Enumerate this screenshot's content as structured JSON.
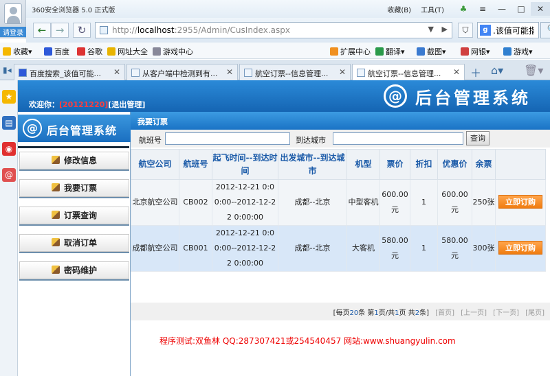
{
  "browser": {
    "app_title": "360安全浏览器 5.0 正式版",
    "login_label": "请登录",
    "menu_collect": "收藏(B)",
    "menu_tools": "工具(T)",
    "url_prefix": "http://",
    "url_host": "localhost",
    "url_rest": ":2955/Admin/CusIndex.aspx",
    "search_text": ".该值可能指",
    "bookmarks": {
      "fav": "收藏",
      "baidu": "百度",
      "google": "谷歌",
      "sites": "网址大全",
      "games": "游戏中心",
      "ext": "扩展中心",
      "translate": "翻译",
      "screenshot": "截图",
      "bank": "网银",
      "game2": "游戏"
    },
    "tabs": [
      {
        "title": "百度搜索_该值可能..."
      },
      {
        "title": "从客户端中检测到有..."
      },
      {
        "title": "航空订票--信息管理..."
      },
      {
        "title": "航空订票--信息管理..."
      }
    ]
  },
  "site": {
    "welcome_prefix": "欢迎你：",
    "user_id": "[20121220]",
    "logout": "[退出管理]",
    "logo_text": "后台管理系统",
    "nav_logo_text": "后台管理系统",
    "nav": [
      {
        "label": "修改信息"
      },
      {
        "label": "我要订票"
      },
      {
        "label": "订票查询"
      },
      {
        "label": "取消订单"
      },
      {
        "label": "密码维护"
      }
    ]
  },
  "main": {
    "title": "我要订票",
    "filter": {
      "flight_label": "航班号",
      "flight_value": "",
      "city_label": "到达城市",
      "city_value": "",
      "query_button": "查询"
    },
    "columns": [
      "航空公司",
      "航班号",
      "起飞时间--到达时间",
      "出发城市--到达城市",
      "机型",
      "票价",
      "折扣",
      "优惠价",
      "余票",
      ""
    ],
    "rows": [
      {
        "airline": "北京航空公司",
        "flight": "CB002",
        "time": "2012-12-21 0:00:00--2012-12-22 0:00:00",
        "route": "成都--北京",
        "model": "中型客机",
        "price": "600.00元",
        "discount": "1",
        "sale": "600.00元",
        "left": "250张",
        "action": "立即订购"
      },
      {
        "airline": "成都航空公司",
        "flight": "CB001",
        "time": "2012-12-21 0:00:00--2012-12-22 0:00:00",
        "route": "成都--北京",
        "model": "大客机",
        "price": "580.00元",
        "discount": "1",
        "sale": "580.00元",
        "left": "300张",
        "action": "立即订购"
      }
    ],
    "pager": {
      "per_page_pre": "[每页",
      "per_page": "20",
      "per_page_post": "条 第",
      "page": "1",
      "page_sep": "页/共",
      "pages": "1",
      "pages_post": "页 共",
      "total": "2",
      "total_post": "条]",
      "first": "[首页]",
      "prev": "[上一页]",
      "next": "[下一页]",
      "last": "[尾页]"
    },
    "footer": "程序测试:双鱼林  QQ:287307421或254540457 网站:www.shuangyulin.com"
  }
}
